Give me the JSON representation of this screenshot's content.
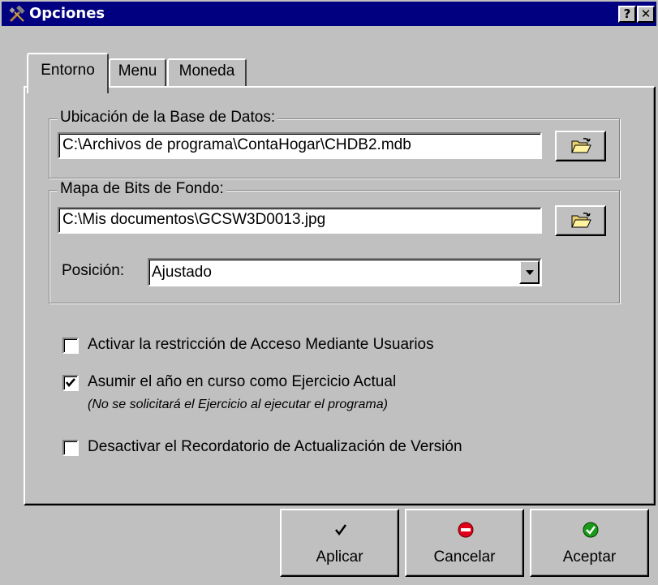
{
  "window": {
    "title": "Opciones",
    "help_glyph": "?",
    "close_glyph": "✕",
    "title_bar_color": "#000080",
    "face_color": "#c0c0c0"
  },
  "tabs": [
    {
      "label": "Entorno",
      "selected": true
    },
    {
      "label": "Menu",
      "selected": false
    },
    {
      "label": "Moneda",
      "selected": false
    }
  ],
  "database": {
    "legend": "Ubicación de la Base de Datos:",
    "path": "C:\\Archivos de programa\\ContaHogar\\CHDB2.mdb",
    "browse_icon": "open-folder-icon"
  },
  "bitmap": {
    "legend": "Mapa de Bits de Fondo:",
    "path": "C:\\Mis documentos\\GCSW3D0013.jpg",
    "browse_icon": "open-folder-icon",
    "position_label": "Posición:",
    "position_value": "Ajustado"
  },
  "options": [
    {
      "label": "Activar la restricción de Acceso Mediante Usuarios",
      "checked": false
    },
    {
      "label": "Asumir el año en curso como Ejercicio Actual",
      "checked": true,
      "note": "(No se solicitará el Ejercicio al ejecutar el programa)"
    },
    {
      "label": "Desactivar el Recordatorio de Actualización de Versión",
      "checked": false
    }
  ],
  "buttons": {
    "apply": {
      "label": "Aplicar",
      "icon": "checkmark-icon"
    },
    "cancel": {
      "label": "Cancelar",
      "icon": "stop-icon",
      "icon_color": "#e0001b"
    },
    "accept": {
      "label": "Aceptar",
      "icon": "green-check-icon",
      "icon_color": "#1a9a1a"
    }
  }
}
